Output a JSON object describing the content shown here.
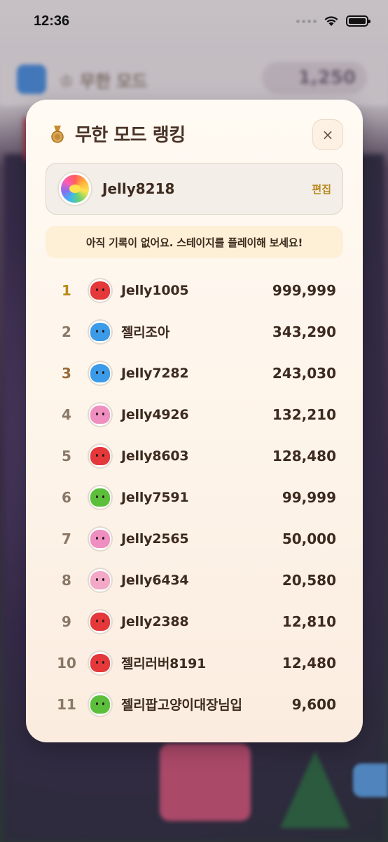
{
  "status_bar": {
    "time": "12:36"
  },
  "background": {
    "mode_label": "♔ 무한 모드",
    "gems": "1,250"
  },
  "modal": {
    "title": "무한 모드 랭킹",
    "close_label": "×",
    "profile": {
      "name": "Jelly8218",
      "edit_label": "편집",
      "avatar_icon": "rainbow-jelly-icon"
    },
    "notice": "아직 기록이 없어요. 스테이지를 플레이해 보세요!",
    "rankings": [
      {
        "rank": "1",
        "name": "Jelly1005",
        "score": "999,999",
        "jelly_color": "#e4383a"
      },
      {
        "rank": "2",
        "name": "젤리조아",
        "score": "343,290",
        "jelly_color": "#3b9be8"
      },
      {
        "rank": "3",
        "name": "Jelly7282",
        "score": "243,030",
        "jelly_color": "#3b9be8"
      },
      {
        "rank": "4",
        "name": "Jelly4926",
        "score": "132,210",
        "jelly_color": "#ef8fc0"
      },
      {
        "rank": "5",
        "name": "Jelly8603",
        "score": "128,480",
        "jelly_color": "#e4383a"
      },
      {
        "rank": "6",
        "name": "Jelly7591",
        "score": "99,999",
        "jelly_color": "#5cbf3c"
      },
      {
        "rank": "7",
        "name": "Jelly2565",
        "score": "50,000",
        "jelly_color": "#ef8fc0"
      },
      {
        "rank": "8",
        "name": "Jelly6434",
        "score": "20,580",
        "jelly_color": "#f2a8c6"
      },
      {
        "rank": "9",
        "name": "Jelly2388",
        "score": "12,810",
        "jelly_color": "#e4383a"
      },
      {
        "rank": "10",
        "name": "젤리러버8191",
        "score": "12,480",
        "jelly_color": "#e4383a"
      },
      {
        "rank": "11",
        "name": "젤리팝고양이대장님입",
        "score": "9,600",
        "jelly_color": "#5cbf3c"
      }
    ]
  }
}
